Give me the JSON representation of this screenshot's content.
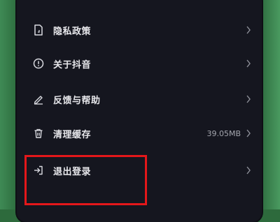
{
  "icons": {
    "privacy": "document-icon",
    "about": "info-icon",
    "feedback": "pencil-icon",
    "cache": "trash-icon",
    "logout": "logout-icon",
    "chevron": "chevron-right-icon"
  },
  "colors": {
    "background": "#2d6a3c",
    "panel": "#15161f",
    "text": "#e8e8ec",
    "muted": "#a4a6ae",
    "highlight": "#e4171a"
  },
  "settings": {
    "items": [
      {
        "label": "隐私政策"
      },
      {
        "label": "关于抖音"
      },
      {
        "label": "反馈与帮助"
      },
      {
        "label": "清理缓存",
        "value": "39.05MB"
      },
      {
        "label": "退出登录"
      }
    ]
  }
}
